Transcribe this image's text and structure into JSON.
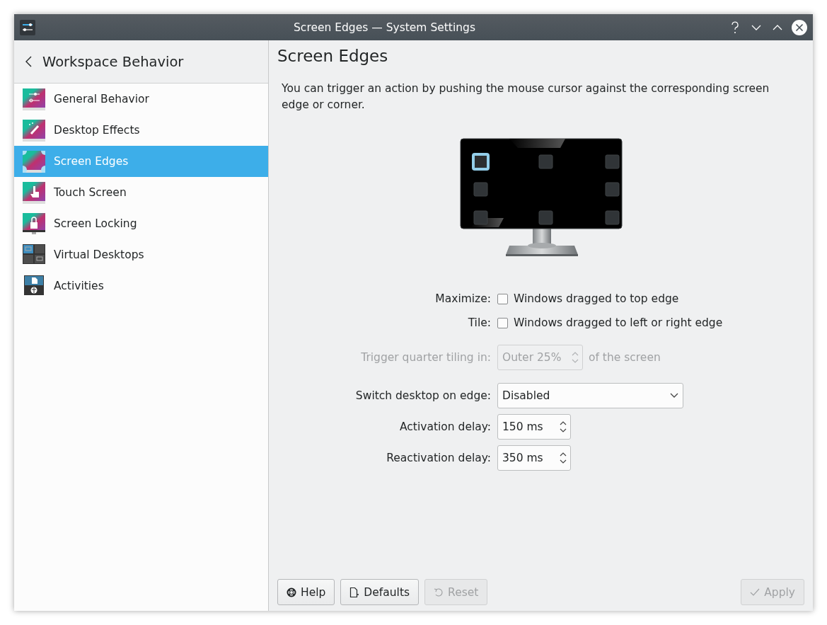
{
  "window": {
    "title": "Screen Edges — System Settings"
  },
  "sidebar": {
    "back_title": "Workspace Behavior",
    "items": [
      {
        "label": "General Behavior",
        "selected": false
      },
      {
        "label": "Desktop Effects",
        "selected": false
      },
      {
        "label": "Screen Edges",
        "selected": true
      },
      {
        "label": "Touch Screen",
        "selected": false
      },
      {
        "label": "Screen Locking",
        "selected": false
      },
      {
        "label": "Virtual Desktops",
        "selected": false
      },
      {
        "label": "Activities",
        "selected": false
      }
    ]
  },
  "page": {
    "title": "Screen Edges",
    "description": "You can trigger an action by pushing the mouse cursor against the corresponding screen edge or corner.",
    "edges": [
      {
        "selected": true
      },
      {
        "selected": false
      },
      {
        "selected": false
      },
      {
        "selected": false
      },
      {
        "selected": false
      },
      {
        "selected": false
      },
      {
        "selected": false
      },
      {
        "selected": false
      }
    ],
    "rows": [
      {
        "kind": "checkbox",
        "label": "Maximize:",
        "text": "Windows dragged to top edge",
        "checked": false
      },
      {
        "kind": "checkbox",
        "label": "Tile:",
        "text": "Windows dragged to left or right edge",
        "checked": false
      },
      {
        "kind": "spin",
        "label": "Trigger quarter tiling in:",
        "value": "Outer 25%",
        "suffix": "of the screen",
        "disabled": true
      },
      {
        "kind": "dropdown",
        "label": "Switch desktop on edge:",
        "value": "Disabled"
      },
      {
        "kind": "spin",
        "label": "Activation delay:",
        "value": "150 ms",
        "disabled": false
      },
      {
        "kind": "spin",
        "label": "Reactivation delay:",
        "value": "350 ms",
        "disabled": false
      }
    ]
  },
  "buttons": [
    {
      "label": "Help",
      "disabled": false
    },
    {
      "label": "Defaults",
      "disabled": false
    },
    {
      "label": "Reset",
      "disabled": true
    },
    {
      "label": "Apply",
      "disabled": true
    }
  ]
}
